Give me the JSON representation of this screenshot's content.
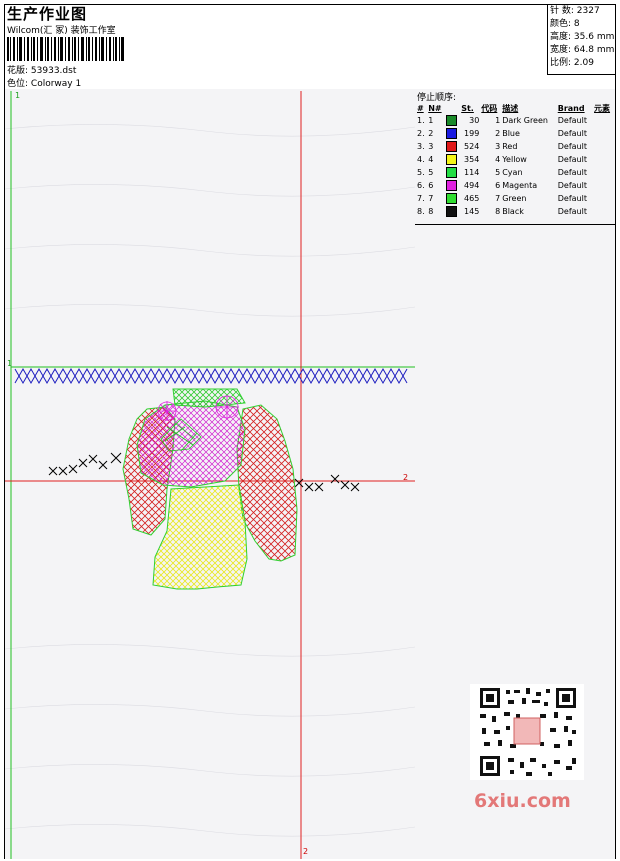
{
  "header": {
    "title": "生产作业图",
    "company": "Wilcom(汇 冢) 装饰工作室",
    "design_label": "花版:",
    "design_value": "53933.dst",
    "colorway_label": "色位:",
    "colorway_value": "Colorway 1"
  },
  "stats": {
    "stitches_label": "针 数:",
    "stitches": "2327",
    "colors_label": "颜色:",
    "colors": "8",
    "height_label": "高度:",
    "height": "35.6 mm",
    "width_label": "宽度:",
    "width": "64.8 mm",
    "ratio_label": "比例:",
    "ratio": "2.09"
  },
  "panel": {
    "title": "停止顺序:",
    "columns": [
      "#",
      "N#",
      "St.",
      "代码",
      "描述",
      "Brand",
      "元素"
    ],
    "rows": [
      {
        "idx": "1.",
        "n": "1",
        "color": "#1a8a2a",
        "st": "30",
        "code": "1",
        "desc": "Dark Green",
        "brand": "Default"
      },
      {
        "idx": "2.",
        "n": "2",
        "color": "#1a1ae0",
        "st": "199",
        "code": "2",
        "desc": "Blue",
        "brand": "Default"
      },
      {
        "idx": "3.",
        "n": "3",
        "color": "#e01818",
        "st": "524",
        "code": "3",
        "desc": "Red",
        "brand": "Default"
      },
      {
        "idx": "4.",
        "n": "4",
        "color": "#f5f518",
        "st": "354",
        "code": "4",
        "desc": "Yellow",
        "brand": "Default"
      },
      {
        "idx": "5.",
        "n": "5",
        "color": "#22dd44",
        "st": "114",
        "code": "5",
        "desc": "Cyan",
        "brand": "Default"
      },
      {
        "idx": "6.",
        "n": "6",
        "color": "#e020e0",
        "st": "494",
        "code": "6",
        "desc": "Magenta",
        "brand": "Default"
      },
      {
        "idx": "7.",
        "n": "7",
        "color": "#30dd30",
        "st": "465",
        "code": "7",
        "desc": "Green",
        "brand": "Default"
      },
      {
        "idx": "8.",
        "n": "8",
        "color": "#111111",
        "st": "145",
        "code": "8",
        "desc": "Black",
        "brand": "Default"
      }
    ]
  },
  "axis": {
    "v1": "1",
    "h1": "1",
    "h2": "2",
    "v2": "2"
  },
  "watermark": "6xiu.com"
}
